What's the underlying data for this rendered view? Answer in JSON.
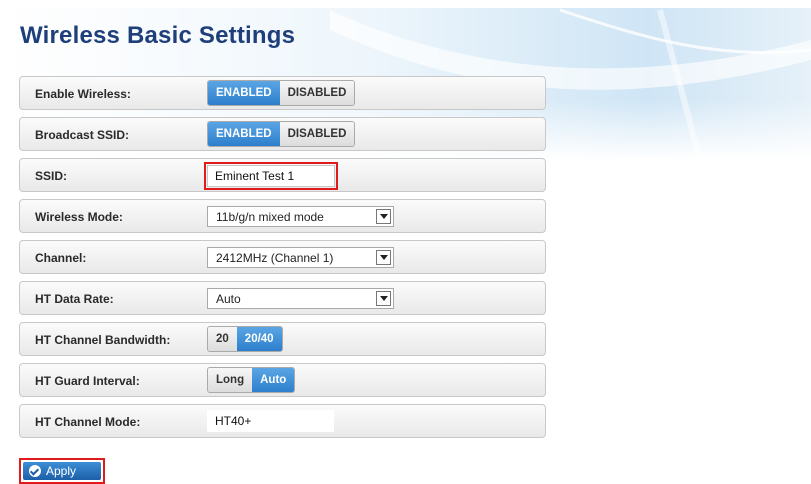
{
  "page": {
    "title": "Wireless Basic Settings"
  },
  "rows": {
    "enable_wireless": {
      "label": "Enable Wireless:",
      "options": [
        "ENABLED",
        "DISABLED"
      ],
      "selected": "ENABLED"
    },
    "broadcast_ssid": {
      "label": "Broadcast SSID:",
      "options": [
        "ENABLED",
        "DISABLED"
      ],
      "selected": "ENABLED"
    },
    "ssid": {
      "label": "SSID:",
      "value": "Eminent Test 1"
    },
    "wireless_mode": {
      "label": "Wireless Mode:",
      "value": "11b/g/n mixed mode"
    },
    "channel": {
      "label": "Channel:",
      "value": "2412MHz (Channel 1)"
    },
    "ht_data_rate": {
      "label": "HT Data Rate:",
      "value": "Auto"
    },
    "ht_channel_bandwidth": {
      "label": "HT Channel Bandwidth:",
      "options": [
        "20",
        "20/40"
      ],
      "selected": "20/40"
    },
    "ht_guard_interval": {
      "label": "HT Guard Interval:",
      "options": [
        "Long",
        "Auto"
      ],
      "selected": "Auto"
    },
    "ht_channel_mode": {
      "label": "HT Channel Mode:",
      "value": "HT40+"
    }
  },
  "actions": {
    "apply_label": "Apply"
  },
  "colors": {
    "title": "#1f3f7a",
    "toggle_on": "#2d7fcc",
    "highlight": "#e01b1b"
  }
}
